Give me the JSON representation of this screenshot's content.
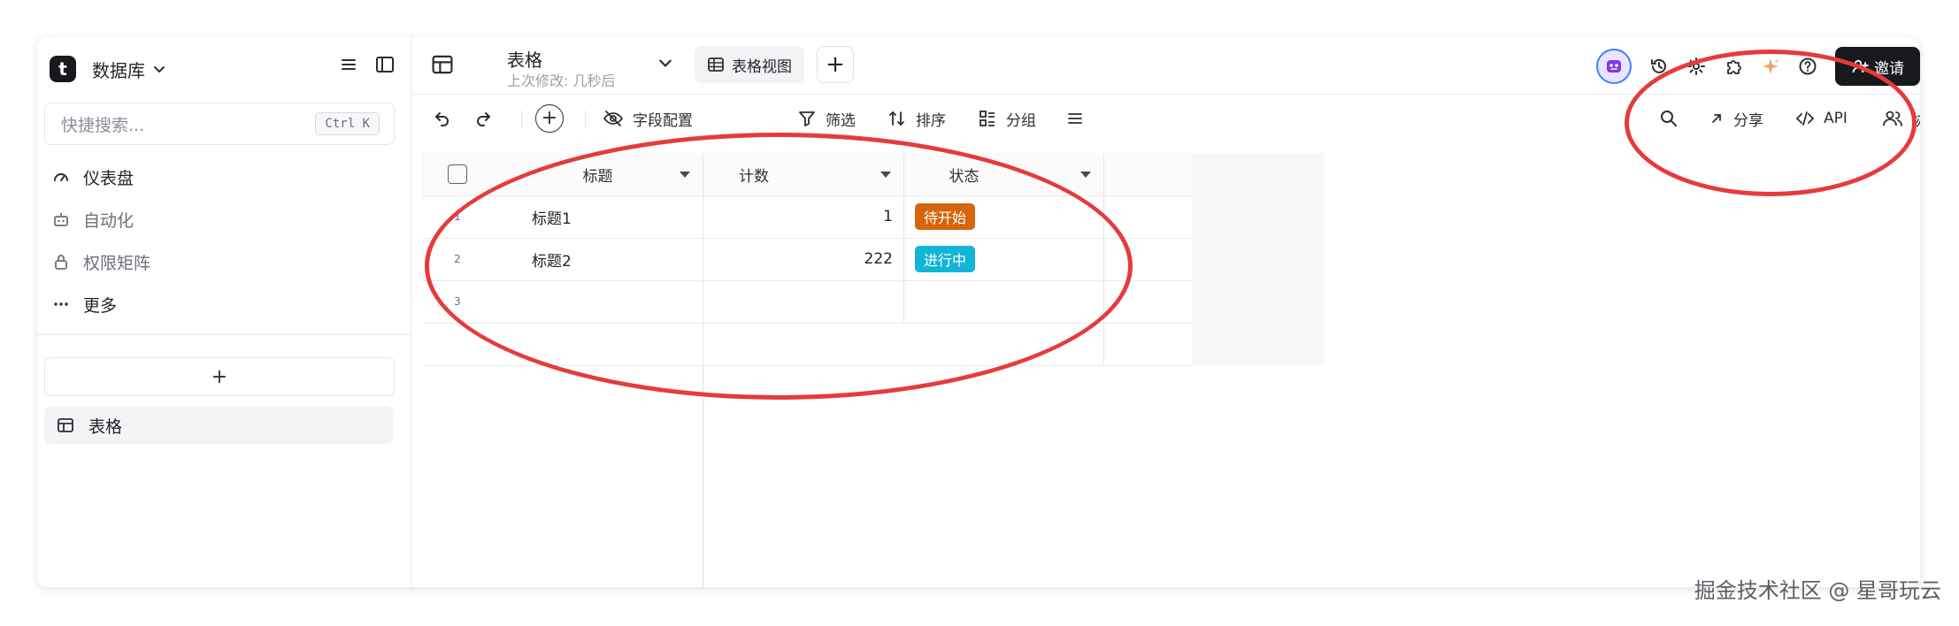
{
  "sidebar": {
    "logo_letter": "t",
    "base_name": "数据库",
    "search_placeholder": "快捷搜索...",
    "search_shortcut": "Ctrl K",
    "nav": [
      {
        "label": "仪表盘",
        "icon": "gauge-icon"
      },
      {
        "label": "自动化",
        "icon": "robot-icon"
      },
      {
        "label": "权限矩阵",
        "icon": "lock-icon"
      },
      {
        "label": "更多",
        "icon": "more-dots-icon"
      }
    ],
    "add_label": "+",
    "tables": [
      {
        "label": "表格",
        "icon": "table-icon"
      }
    ]
  },
  "header": {
    "title": "表格",
    "last_modified": "上次修改:  几秒后",
    "view_tab": "表格视图",
    "view_add": "+",
    "invite_label": "邀请"
  },
  "toolbar": {
    "field_config": "字段配置",
    "filter": "筛选",
    "sort": "排序",
    "group": "分组",
    "share": "分享",
    "api": "API",
    "collaborate": "协同"
  },
  "grid": {
    "columns": [
      "标题",
      "计数",
      "状态"
    ],
    "rows": [
      {
        "num": "1",
        "title": "标题1",
        "count": "1",
        "status": "待开始",
        "status_color": "#d4660f"
      },
      {
        "num": "2",
        "title": "标题2",
        "count": "222",
        "status": "进行中",
        "status_color": "#13b5d6"
      },
      {
        "num": "3",
        "title": "",
        "count": "",
        "status": "",
        "status_color": ""
      }
    ]
  },
  "annotation_color": "#e63b3b",
  "watermark": "掘金技术社区 @ 星哥玩云"
}
